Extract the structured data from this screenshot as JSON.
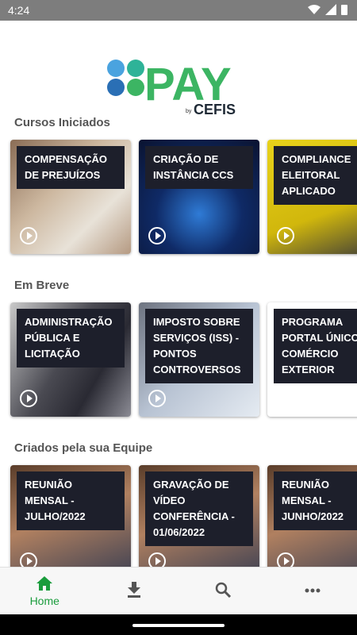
{
  "status": {
    "time": "4:24"
  },
  "logo": {
    "text": "PAY",
    "by": "by",
    "brand": "CEFIS"
  },
  "sections": {
    "started": {
      "title": "Cursos Iniciados",
      "cards": [
        {
          "label": "Compensação de Prejuízos"
        },
        {
          "label": "Criação de Instância CCS"
        },
        {
          "label": "Compliance Eleitoral Aplicado"
        }
      ]
    },
    "soon": {
      "title": "Em Breve",
      "cards": [
        {
          "label": "Administração Pública e Licitação"
        },
        {
          "label": "Imposto sobre Serviços (ISS) - Pontos Controversos"
        },
        {
          "label": "Programa Portal Único Comércio Exterior"
        }
      ]
    },
    "team": {
      "title": "Criados pela sua Equipe",
      "cards": [
        {
          "label": "Reunião Mensal - Julho/2022"
        },
        {
          "label": "Gravação de Vídeo Conferência - 01/06/2022"
        },
        {
          "label": "Reunião Mensal - Junho/2022"
        }
      ]
    }
  },
  "bottom_nav": {
    "home_label": "Home",
    "accent": "#1a9c3c"
  }
}
